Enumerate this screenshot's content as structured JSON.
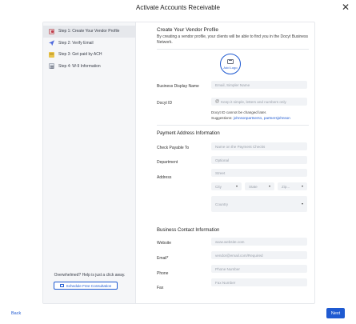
{
  "modal": {
    "title": "Activate Accounts Receivable"
  },
  "steps": [
    {
      "label": "Step 1: Create Your Vendor Profile",
      "icon": "profile-icon"
    },
    {
      "label": "Step 2: Verify Email",
      "icon": "paper-plane-icon"
    },
    {
      "label": "Step 3: Get paid by ACH",
      "icon": "money-icon"
    },
    {
      "label": "Step 4: W-9 Information",
      "icon": "document-icon"
    }
  ],
  "help": {
    "text": "Overwhelmed? Help is just a click away.",
    "button": "Schedule Free Consultation"
  },
  "form": {
    "title": "Create Your Vendor Profile",
    "description": "By creating a vendor profile, your clients will be able to find you in the Docyt Business Network.",
    "logo_label": "Add Logo",
    "business_name": {
      "label": "Business Display Name",
      "placeholder": "Email, Simpler Name"
    },
    "docyt_id": {
      "label": "Docyt ID",
      "placeholder": "Keep it simple, letters and numbers only",
      "note": "Docyt ID cannot be changed later.",
      "suggestions_label": "Suggestions:",
      "suggestions": "johnsonpartners1, partnersjohnson"
    },
    "payment_section": "Payment Address Information",
    "check_payable": {
      "label": "Check Payable To",
      "placeholder": "Name on the Payment Checks"
    },
    "department": {
      "label": "Department",
      "placeholder": "Optional"
    },
    "address": {
      "label": "Address",
      "street": "Street",
      "city": "City",
      "state": "State",
      "zip": "Zip...",
      "country": "Country"
    },
    "contact_section": "Business Contact Information",
    "website": {
      "label": "Website",
      "placeholder": "www.website.com"
    },
    "email": {
      "label": "Email*",
      "placeholder": "vendor@email.com/Required"
    },
    "phone": {
      "label": "Phone",
      "placeholder": "Phone Number"
    },
    "fax": {
      "label": "Fax",
      "placeholder": "Fax Number"
    }
  },
  "footer": {
    "back": "Back",
    "next": "Next"
  },
  "colors": {
    "accent": "#1f5ad1",
    "sidebar_bg": "#f5f6f8",
    "field_bg": "#f1f3f6"
  }
}
